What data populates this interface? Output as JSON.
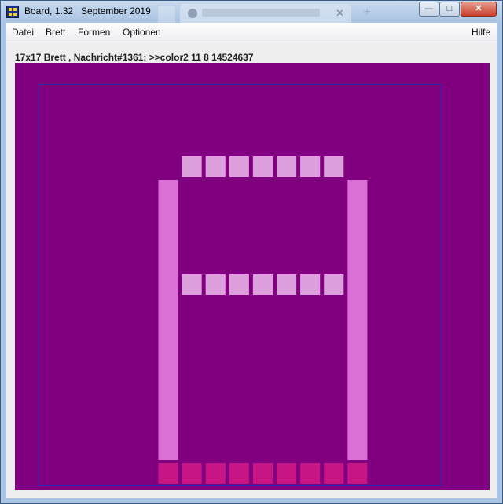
{
  "window": {
    "title": "Board, 1.32   September 2019",
    "controls": {
      "minimize": "—",
      "maximize": "□",
      "close": "✕"
    }
  },
  "browser_tab": {
    "close_glyph": "✕",
    "new_tab_glyph": "+"
  },
  "menu": {
    "datei": "Datei",
    "brett": "Brett",
    "formen": "Formen",
    "optionen": "Optionen",
    "hilfe": "Hilfe"
  },
  "status": "17x17 Brett , Nachricht#1361: >>color2 11 8 14524637",
  "board": {
    "background": "#800080",
    "grid_border": "#2a2ab6",
    "colors": {
      "light": "#dda0dd",
      "orchid": "#da70d6",
      "medium_violet_red": "#c71585"
    },
    "top_row": {
      "columns": [
        6,
        7,
        8,
        9,
        10,
        11,
        12
      ],
      "row": 13,
      "color": "light"
    },
    "middle_row": {
      "columns": [
        6,
        7,
        8,
        9,
        10,
        11,
        12
      ],
      "row": 8,
      "color": "light"
    },
    "left_bar": {
      "column": 5,
      "rows_from": 1,
      "rows_to": 12,
      "color": "orchid"
    },
    "right_bar": {
      "column": 13,
      "rows_from": 1,
      "rows_to": 12,
      "color": "orchid"
    },
    "bottom_row": {
      "columns": [
        5,
        6,
        7,
        8,
        9,
        10,
        11,
        12,
        13
      ],
      "row": 0,
      "color": "medium_violet_red"
    }
  }
}
